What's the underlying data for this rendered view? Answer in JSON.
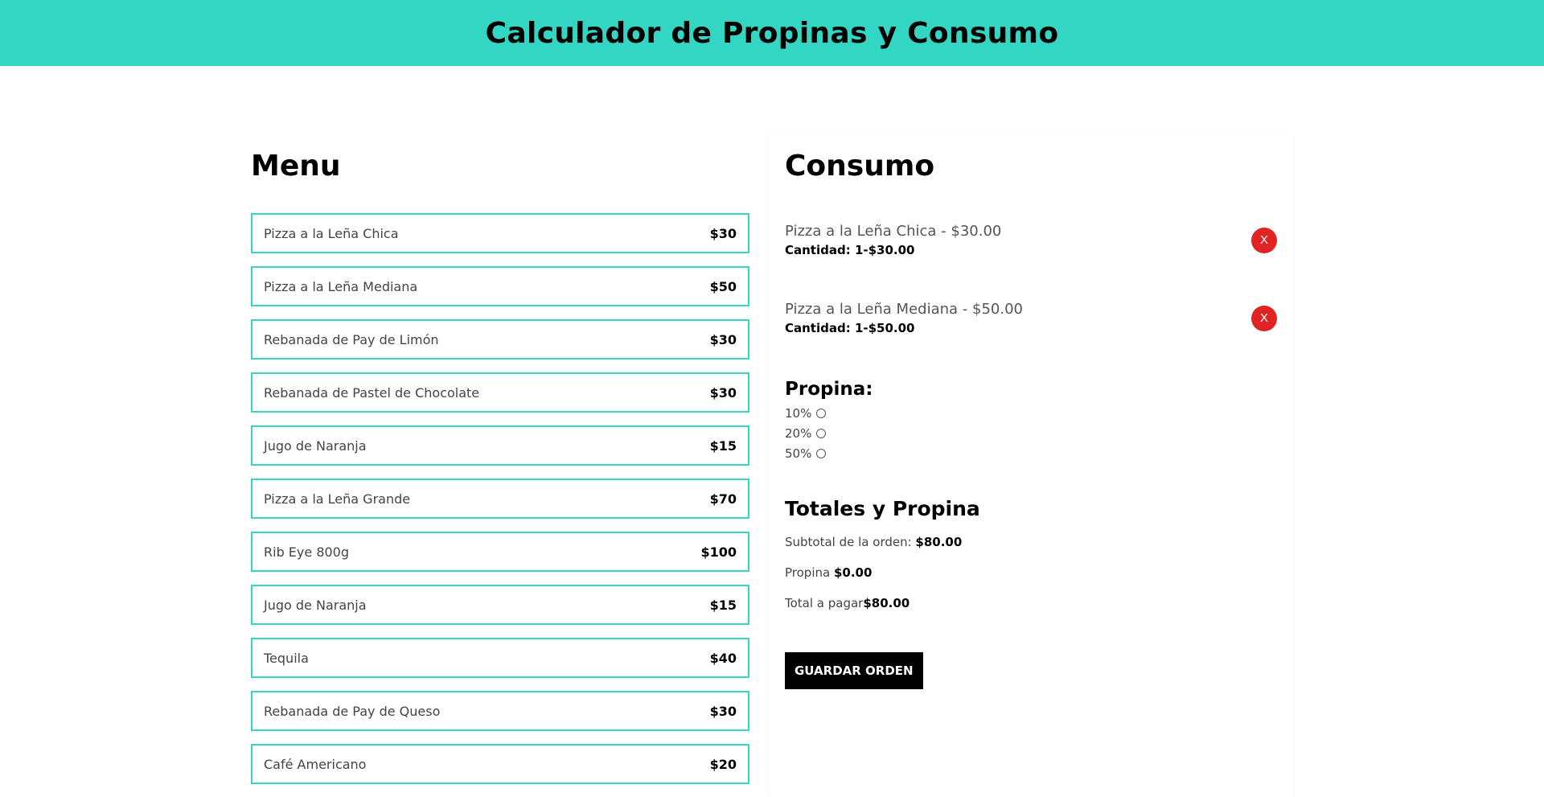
{
  "header": {
    "title": "Calculador de Propinas y Consumo"
  },
  "menu": {
    "title": "Menu",
    "items": [
      {
        "name": "Pizza a la Leña Chica",
        "price": "$30"
      },
      {
        "name": "Pizza a la Leña Mediana",
        "price": "$50"
      },
      {
        "name": "Rebanada de Pay de Limón",
        "price": "$30"
      },
      {
        "name": "Rebanada de Pastel de Chocolate",
        "price": "$30"
      },
      {
        "name": "Jugo de Naranja",
        "price": "$15"
      },
      {
        "name": "Pizza a la Leña Grande",
        "price": "$70"
      },
      {
        "name": "Rib Eye 800g",
        "price": "$100"
      },
      {
        "name": "Jugo de Naranja",
        "price": "$15"
      },
      {
        "name": "Tequila",
        "price": "$40"
      },
      {
        "name": "Rebanada de Pay de Queso",
        "price": "$30"
      },
      {
        "name": "Café Americano",
        "price": "$20"
      }
    ]
  },
  "consumo": {
    "title": "Consumo",
    "items": [
      {
        "label": "Pizza a la Leña Chica - $30.00",
        "qty": "Cantidad: 1-$30.00",
        "remove_label": "X"
      },
      {
        "label": "Pizza a la Leña Mediana - $50.00",
        "qty": "Cantidad: 1-$50.00",
        "remove_label": "X"
      }
    ],
    "propina": {
      "title": "Propina:",
      "options": [
        "10%",
        "20%",
        "50%"
      ]
    },
    "totales": {
      "title": "Totales y Propina",
      "subtotal_label": "Subtotal de la orden: ",
      "subtotal_value": "$80.00",
      "propina_label": "Propina ",
      "propina_value": "$0.00",
      "total_label": "Total a pagar",
      "total_value": "$80.00"
    },
    "save_label": "GUARDAR ORDEN"
  },
  "colors": {
    "accent": "#33d6c3",
    "remove": "#e02424",
    "button": "#000000"
  }
}
